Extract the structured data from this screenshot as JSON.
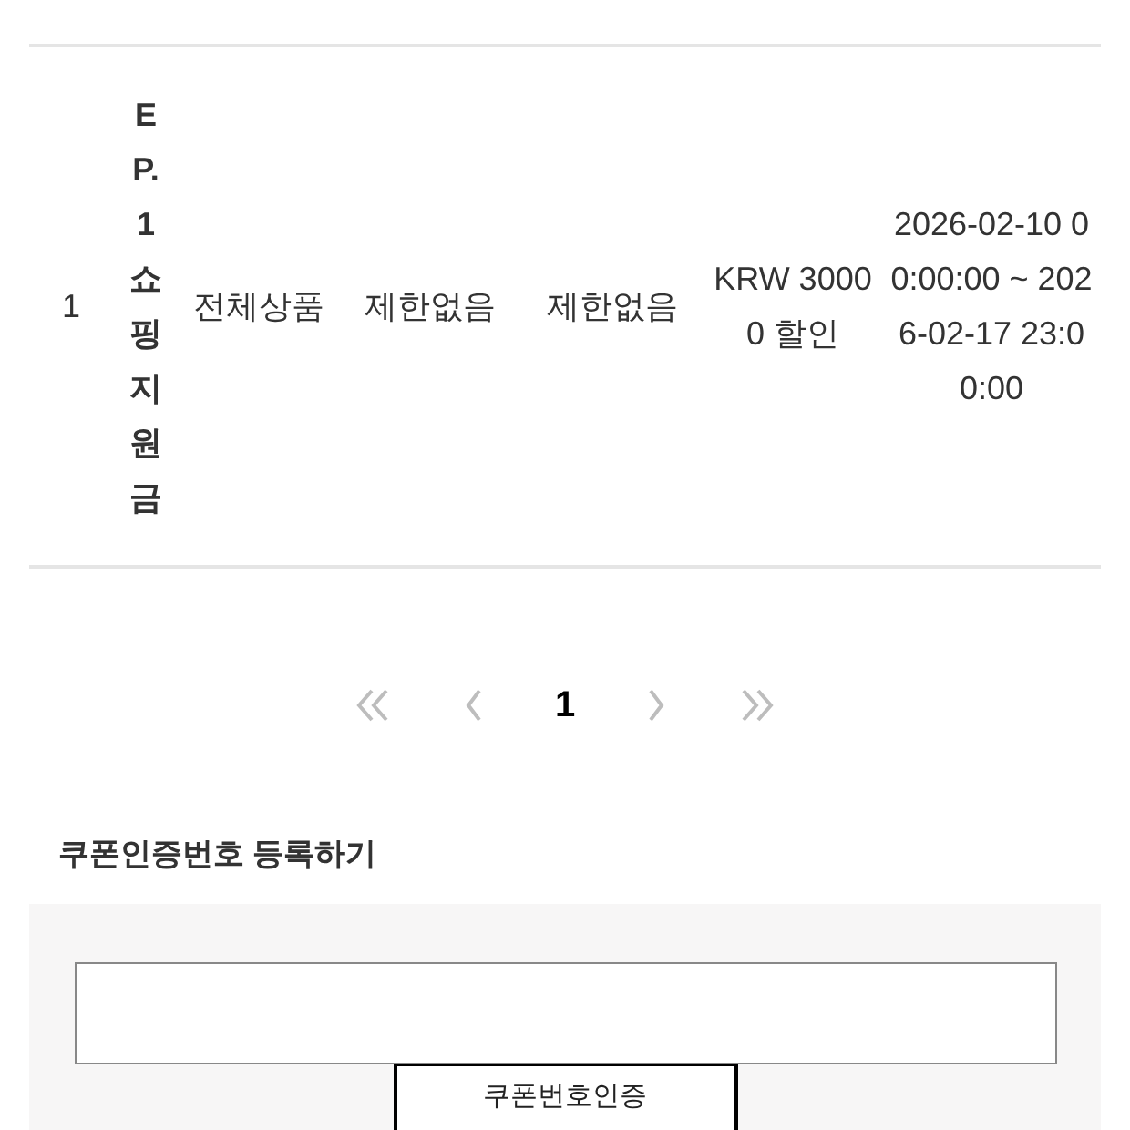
{
  "table": {
    "rows": [
      {
        "column_1": "1",
        "column_2": "EP.1쇼핑지원금",
        "column_3": "전체상품",
        "column_4": "제한없음",
        "column_5": "제한없음",
        "column_6": "KRW 30000 할인",
        "column_7": "2026-02-10 00:00:00 ~ 2026-02-17 23:00:00"
      }
    ]
  },
  "pagination": {
    "pages": [
      {
        "label": "1",
        "selected": true
      }
    ]
  },
  "coupon_form": {
    "title": "쿠폰인증번호 등록하기",
    "button": "쿠폰번호인증"
  }
}
